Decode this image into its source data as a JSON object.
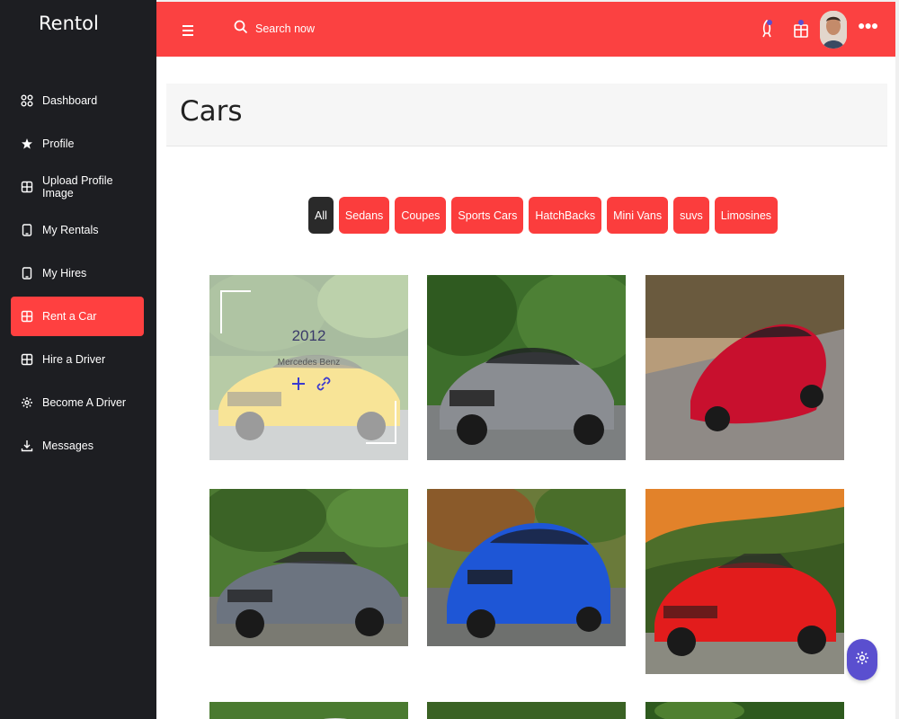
{
  "brand": "Rentol",
  "sidebar": {
    "items": [
      {
        "label": "Dashboard",
        "icon": "grid-icon",
        "active": false
      },
      {
        "label": "Profile",
        "icon": "star-icon",
        "active": false
      },
      {
        "label": "Upload Profile Image",
        "icon": "square-grid-icon",
        "active": false
      },
      {
        "label": "My Rentals",
        "icon": "tablet-icon",
        "active": false
      },
      {
        "label": "My Hires",
        "icon": "tablet-icon",
        "active": false
      },
      {
        "label": "Rent a Car",
        "icon": "square-grid-icon",
        "active": true
      },
      {
        "label": "Hire a Driver",
        "icon": "square-grid-icon",
        "active": false
      },
      {
        "label": "Become A Driver",
        "icon": "gear-icon",
        "active": false
      },
      {
        "label": "Messages",
        "icon": "download-icon",
        "active": false
      }
    ]
  },
  "header": {
    "search_placeholder": "Search now",
    "icons": [
      "menu-icon",
      "search-icon",
      "rocket-icon",
      "gift-icon",
      "avatar",
      "more-icon"
    ]
  },
  "page": {
    "title": "Cars"
  },
  "filters": [
    {
      "label": "All",
      "active": true
    },
    {
      "label": "Sedans",
      "active": false
    },
    {
      "label": "Coupes",
      "active": false
    },
    {
      "label": "Sports Cars",
      "active": false
    },
    {
      "label": "HatchBacks",
      "active": false
    },
    {
      "label": "Mini Vans",
      "active": false
    },
    {
      "label": "suvs",
      "active": false
    },
    {
      "label": "Limosines",
      "active": false
    }
  ],
  "cards": [
    {
      "overlay": true,
      "year": "2012",
      "name": "Mercedes Benz",
      "car_color": "#f0c419"
    },
    {
      "overlay": false,
      "car_color": "#8a8d92"
    },
    {
      "overlay": false,
      "car_color": "#c8102e"
    },
    {
      "overlay": false,
      "car_color": "#6c7480"
    },
    {
      "overlay": false,
      "car_color": "#1e56d6"
    },
    {
      "overlay": false,
      "car_color": "#e21c1c"
    }
  ],
  "colors": {
    "accent": "#fb4141",
    "sidebar_bg": "#1d1e22",
    "fab": "#5a4fcf"
  }
}
